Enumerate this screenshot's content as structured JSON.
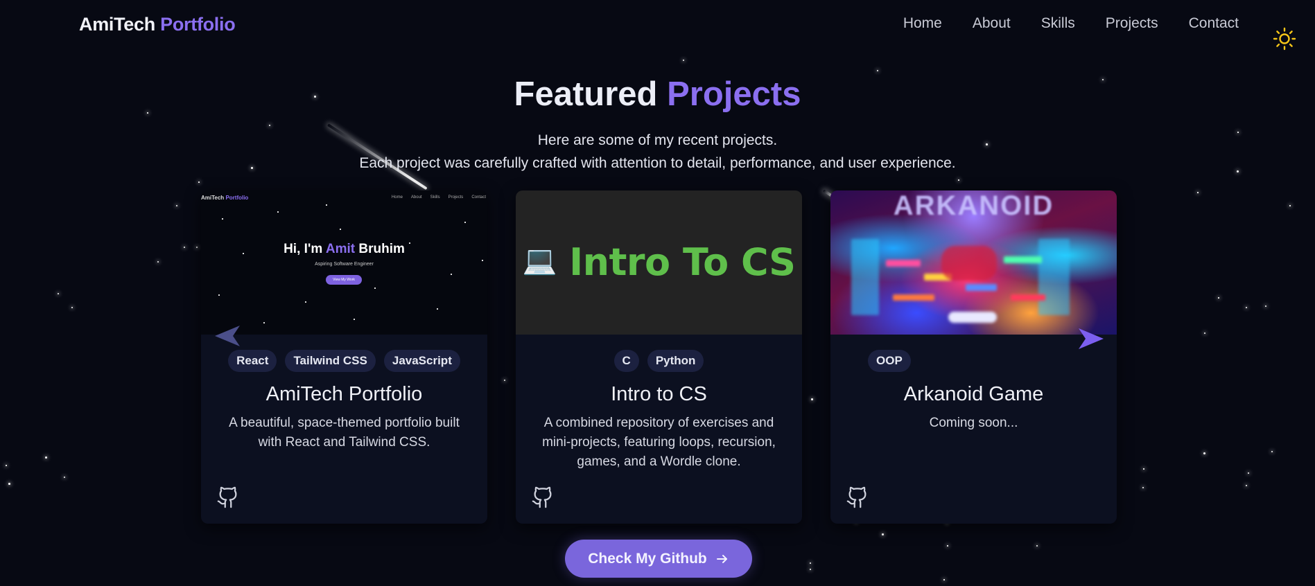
{
  "nav": {
    "logo_main": "AmiTech",
    "logo_accent": "Portfolio",
    "links": [
      "Home",
      "About",
      "Skills",
      "Projects",
      "Contact"
    ],
    "theme_icon": "sun-icon",
    "theme_icon_color": "#f5c518"
  },
  "header": {
    "title_main": "Featured",
    "title_accent": "Projects",
    "subtitle_line1": "Here are some of my recent projects.",
    "subtitle_line2": "Each project was carefully crafted with attention to detail, performance, and user experience."
  },
  "projects": [
    {
      "title": "AmiTech Portfolio",
      "tags": [
        "React",
        "Tailwind CSS",
        "JavaScript"
      ],
      "description": "A beautiful, space-themed portfolio built with React and Tailwind CSS.",
      "preview": {
        "logo_main": "AmiTech",
        "logo_accent": "Portfolio",
        "nav": [
          "Home",
          "About",
          "Skills",
          "Projects",
          "Contact"
        ],
        "hero_prefix": "Hi, I'm",
        "hero_accent": "Amit",
        "hero_suffix": "Bruhim",
        "hero_sub": "Aspiring Software Engineer",
        "hero_button": "View My Work"
      }
    },
    {
      "title": "Intro to CS",
      "tags": [
        "C",
        "Python"
      ],
      "description": "A combined repository of exercises and mini-projects, featuring loops, recursion, games, and a Wordle clone.",
      "preview": {
        "emoji": "💻",
        "label": "Intro To CS"
      }
    },
    {
      "title": "Arkanoid Game",
      "tags": [
        "OOP"
      ],
      "description": "Coming soon...",
      "preview": {
        "label": "ARKANOID"
      }
    }
  ],
  "cta": {
    "label": "Check My Github",
    "icon": "arrow-right-icon"
  },
  "colors": {
    "background": "#070913",
    "accent": "#8b6ff0",
    "card": "#0c1020",
    "tag": "#1c2140",
    "button": "#7a66dc"
  }
}
